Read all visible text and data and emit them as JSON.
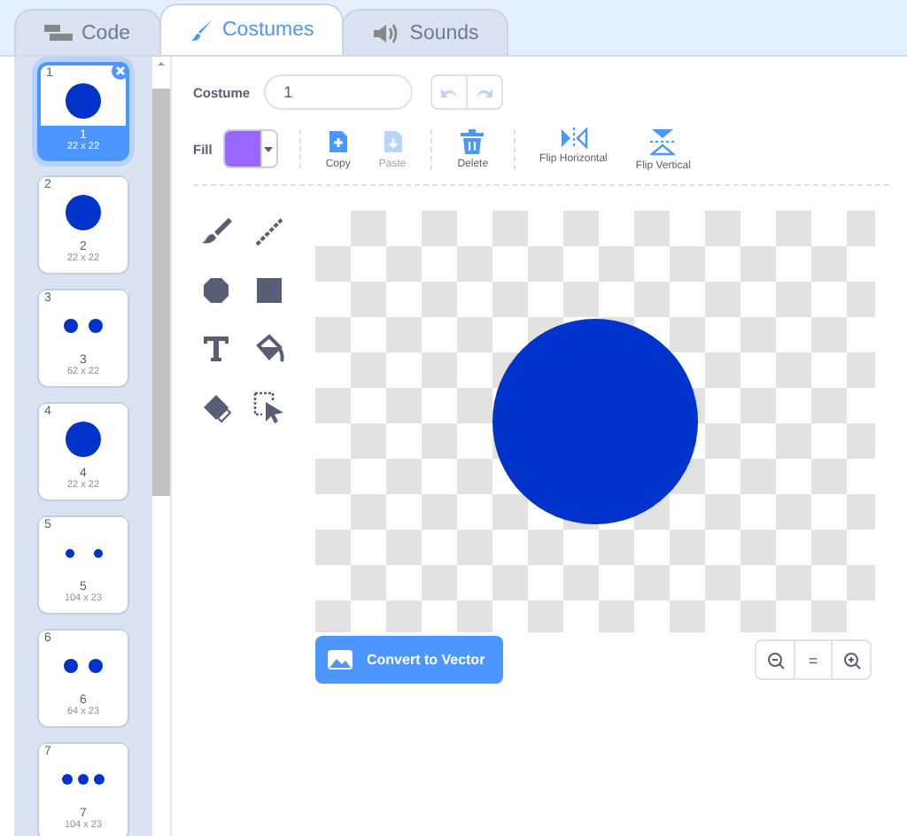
{
  "tabs": [
    {
      "label": "Code",
      "selected": false
    },
    {
      "label": "Costumes",
      "selected": true
    },
    {
      "label": "Sounds",
      "selected": false
    }
  ],
  "costumes": [
    {
      "number": "1",
      "name": "1",
      "size": "22 x 22",
      "kind": "one",
      "selected": true
    },
    {
      "number": "2",
      "name": "2",
      "size": "22 x 22",
      "kind": "one",
      "selected": false
    },
    {
      "number": "3",
      "name": "3",
      "size": "62 x 22",
      "kind": "two",
      "selected": false
    },
    {
      "number": "4",
      "name": "4",
      "size": "22 x 22",
      "kind": "one",
      "selected": false
    },
    {
      "number": "5",
      "name": "5",
      "size": "104 x 23",
      "kind": "two-small",
      "selected": false
    },
    {
      "number": "6",
      "name": "6",
      "size": "64 x 23",
      "kind": "two",
      "selected": false
    },
    {
      "number": "7",
      "name": "7",
      "size": "104 x 23",
      "kind": "three",
      "selected": false
    }
  ],
  "costume_label": "Costume",
  "costume_name": "1",
  "fill": {
    "label": "Fill",
    "color": "#9966ff"
  },
  "actions": [
    {
      "label": "Copy",
      "kind": "copy",
      "disabled": false
    },
    {
      "label": "Paste",
      "kind": "paste",
      "disabled": true
    },
    {
      "label": "Delete",
      "kind": "delete",
      "disabled": false
    },
    {
      "label": "Flip Horizontal",
      "kind": "flip-h",
      "disabled": false
    },
    {
      "label": "Flip Vertical",
      "kind": "flip-v",
      "disabled": false
    }
  ],
  "convert_button": "Convert to Vector",
  "zoom_reset": "="
}
